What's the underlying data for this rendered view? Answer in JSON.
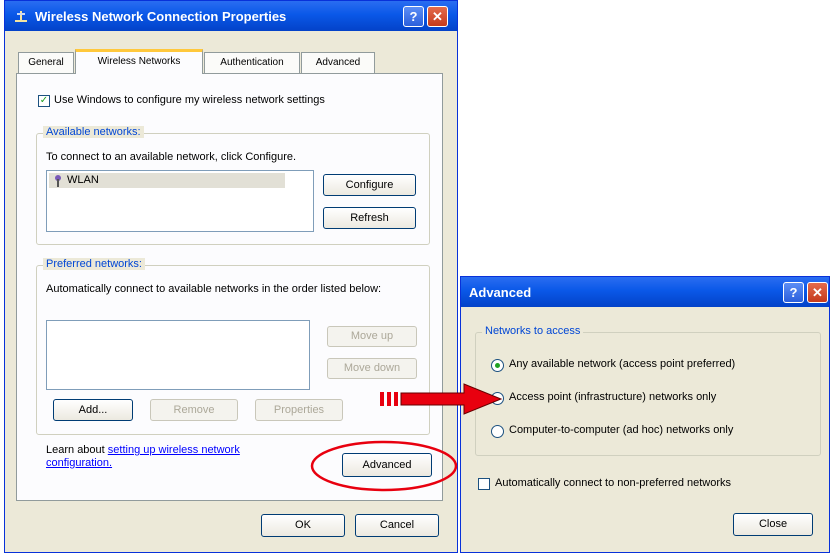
{
  "props_window": {
    "title": "Wireless Network Connection Properties",
    "tabs": [
      "General",
      "Wireless Networks",
      "Authentication",
      "Advanced"
    ],
    "use_windows_checkbox": {
      "label": "Use Windows to configure my wireless network settings",
      "checked": true
    },
    "available": {
      "legend": "Available networks:",
      "instruction": "To connect to an available network, click Configure.",
      "networks": [
        "WLAN"
      ],
      "configure_label": "Configure",
      "refresh_label": "Refresh"
    },
    "preferred": {
      "legend": "Preferred networks:",
      "instruction": "Automatically connect to available networks in the order listed below:",
      "move_up_label": "Move up",
      "move_down_label": "Move down",
      "add_label": "Add...",
      "remove_label": "Remove",
      "properties_label": "Properties"
    },
    "learn_text": "Learn about",
    "learn_link": "setting up wireless network configuration.",
    "advanced_label": "Advanced",
    "ok_label": "OK",
    "cancel_label": "Cancel"
  },
  "advanced_window": {
    "title": "Advanced",
    "legend": "Networks to access",
    "options": [
      "Any available network (access point preferred)",
      "Access point (infrastructure) networks only",
      "Computer-to-computer (ad hoc) networks only"
    ],
    "selected_option": 0,
    "auto_connect_label": "Automatically connect to non-preferred networks",
    "auto_connect_checked": false,
    "close_label": "Close"
  },
  "titlebar_buttons": {
    "help": "?",
    "close": "✕"
  },
  "colors": {
    "annotation_red": "#e8000f",
    "titlebar_blue": "#0a58e8",
    "dialog_bg": "#ece9d8"
  }
}
